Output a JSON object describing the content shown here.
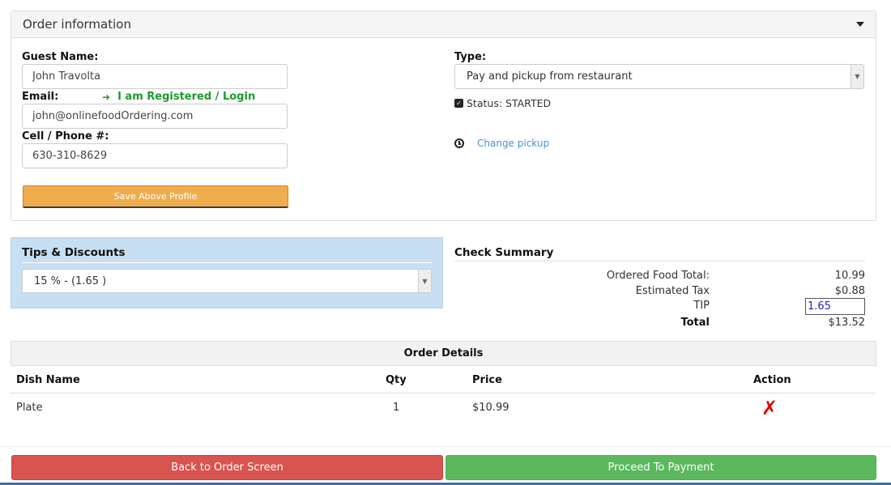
{
  "order_panel": {
    "title": "Order information",
    "guest_name_label": "Guest Name:",
    "guest_name_value": "John Travolta",
    "email_label": "Email:",
    "registered_link": "I am Registered / Login",
    "email_value": "john@onlinefoodOrdering.com",
    "phone_label": "Cell / Phone #:",
    "phone_value": "630-310-8629",
    "save_button": "Save Above Profile",
    "type_label": "Type:",
    "type_value": "Pay and pickup from restaurant",
    "status_text": "Status: STARTED",
    "change_pickup": "Change pickup"
  },
  "tips": {
    "title": "Tips & Discounts",
    "selected": "15 % - (1.65 )"
  },
  "summary": {
    "title": "Check Summary",
    "food_total_label": "Ordered Food Total:",
    "food_total_value": "10.99",
    "tax_label": "Estimated Tax",
    "tax_value": "$0.88",
    "tip_label": "TIP",
    "tip_value": "1.65",
    "total_label": "Total",
    "total_value": "$13.52"
  },
  "details": {
    "title": "Order Details",
    "columns": [
      "Dish Name",
      "Qty",
      "Price",
      "Action"
    ],
    "rows": [
      {
        "dish": "Plate",
        "qty": "1",
        "price": "$10.99"
      }
    ]
  },
  "footer": {
    "back_button": "Back to Order Screen",
    "pay_button": "Proceed To Payment"
  },
  "colors": {
    "save": "#f0ad4e",
    "back": "#d9534f",
    "pay": "#5cb85c",
    "tips_bg": "#c7dff2",
    "link_green": "#1a9a2c"
  }
}
